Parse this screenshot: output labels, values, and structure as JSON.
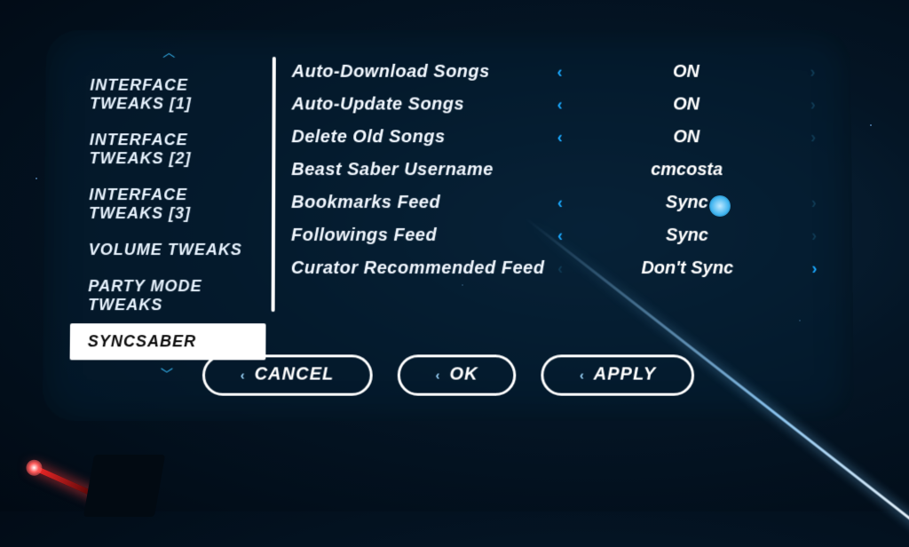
{
  "sidebar": {
    "items": [
      {
        "label": "INTERFACE TWEAKS [1]",
        "active": false
      },
      {
        "label": "INTERFACE TWEAKS [2]",
        "active": false
      },
      {
        "label": "INTERFACE TWEAKS [3]",
        "active": false
      },
      {
        "label": "VOLUME TWEAKS",
        "active": false
      },
      {
        "label": "PARTY MODE TWEAKS",
        "active": false
      },
      {
        "label": "SYNCSABER",
        "active": true
      }
    ]
  },
  "settings": [
    {
      "label": "Auto-Download Songs",
      "value": "ON",
      "left": "bright",
      "right": "dim"
    },
    {
      "label": "Auto-Update Songs",
      "value": "ON",
      "left": "bright",
      "right": "dim"
    },
    {
      "label": "Delete Old Songs",
      "value": "ON",
      "left": "bright",
      "right": "dim"
    },
    {
      "label": "Beast Saber Username",
      "value": "cmcosta",
      "left": "none",
      "right": "none"
    },
    {
      "label": "Bookmarks Feed",
      "value": "Sync",
      "left": "bright",
      "right": "dim"
    },
    {
      "label": "Followings Feed",
      "value": "Sync",
      "left": "bright",
      "right": "dim"
    },
    {
      "label": "Curator Recommended Feed",
      "value": "Don't Sync",
      "left": "dim",
      "right": "bright"
    }
  ],
  "buttons": {
    "cancel": "CANCEL",
    "ok": "OK",
    "apply": "APPLY"
  }
}
